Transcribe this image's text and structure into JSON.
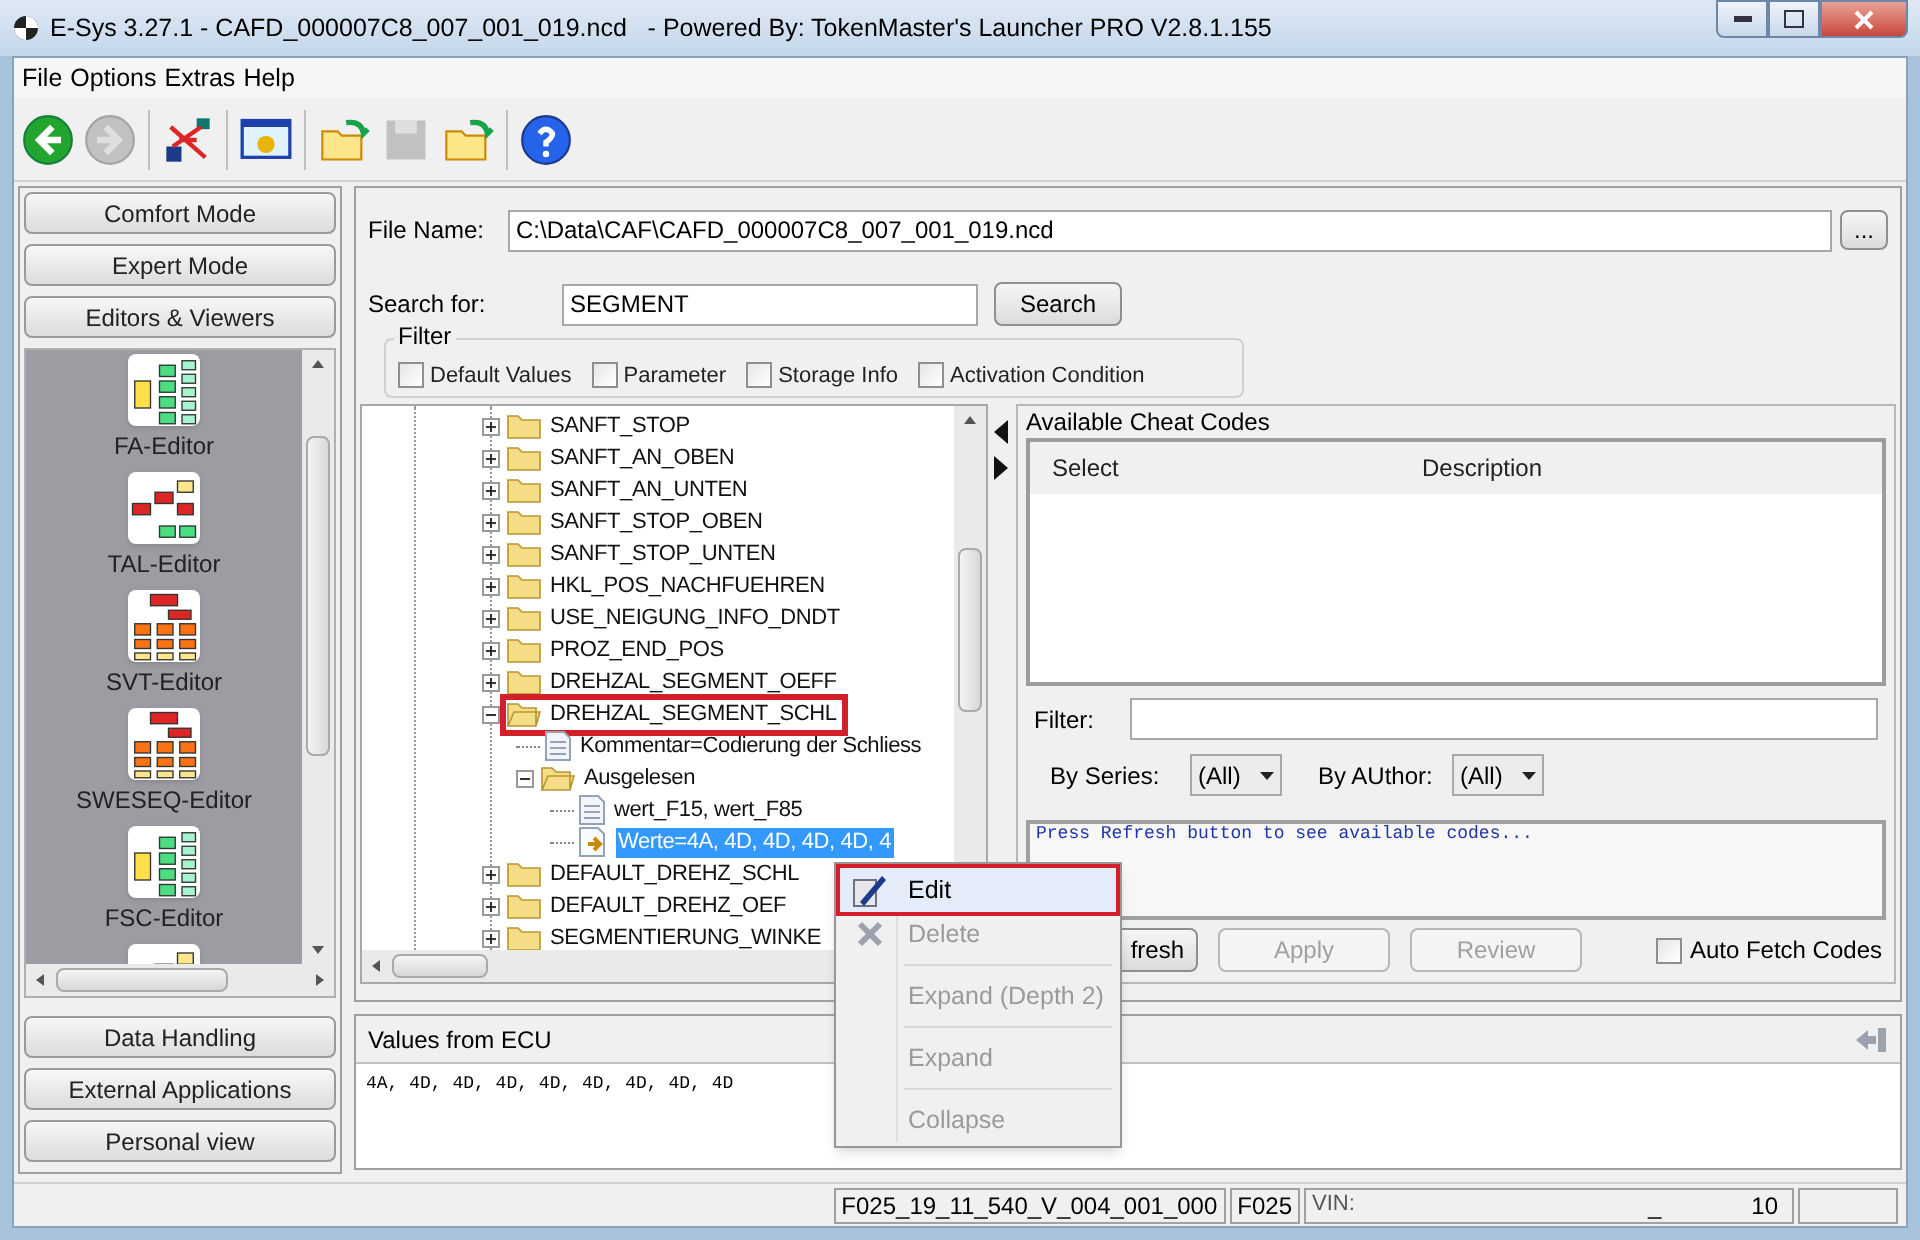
{
  "window": {
    "title": "E-Sys 3.27.1 - CAFD_000007C8_007_001_019.ncd   - Powered By: TokenMaster's Launcher PRO V2.8.1.155"
  },
  "menu": [
    "File",
    "Options",
    "Extras",
    "Help"
  ],
  "toolbar": [
    {
      "kind": "back",
      "disabled": false
    },
    {
      "kind": "forward",
      "disabled": true
    },
    {
      "kind": "network",
      "disabled": false
    },
    {
      "kind": "monitor",
      "disabled": false
    },
    {
      "kind": "open",
      "disabled": false
    },
    {
      "kind": "save",
      "disabled": true
    },
    {
      "kind": "open",
      "disabled": false
    },
    {
      "kind": "help",
      "disabled": false
    }
  ],
  "sidebar": {
    "top_buttons": [
      "Comfort Mode",
      "Expert Mode",
      "Editors & Viewers"
    ],
    "editors": [
      {
        "label": "FA-Editor",
        "kind": "tree"
      },
      {
        "label": "TAL-Editor",
        "kind": "flow"
      },
      {
        "label": "SVT-Editor",
        "kind": "hierarchy"
      },
      {
        "label": "SWESEQ-Editor",
        "kind": "hierarchy"
      },
      {
        "label": "FSC-Editor",
        "kind": "tree"
      },
      {
        "kind": "flow"
      }
    ],
    "bottom_buttons": [
      "Data Handling",
      "External Applications",
      "Personal view"
    ]
  },
  "file_name": {
    "label": "File Name:",
    "value": "C:\\Data\\CAF\\CAFD_000007C8_007_001_019.ncd",
    "browse": "..."
  },
  "search": {
    "label": "Search for:",
    "value": "SEGMENT",
    "button": "Search"
  },
  "filter": {
    "title": "Filter",
    "options": [
      {
        "label": "Default Values",
        "checked": false
      },
      {
        "label": "Parameter",
        "checked": false
      },
      {
        "label": "Storage Info",
        "checked": false
      },
      {
        "label": "Activation Condition",
        "checked": false
      }
    ]
  },
  "tree": [
    {
      "label": "SANFT_STOP",
      "kind": "folder",
      "expanded": false,
      "selected": false,
      "highlighted": false
    },
    {
      "label": "SANFT_AN_OBEN",
      "kind": "folder",
      "expanded": false,
      "selected": false,
      "highlighted": false
    },
    {
      "label": "SANFT_AN_UNTEN",
      "kind": "folder",
      "expanded": false,
      "selected": false,
      "highlighted": false
    },
    {
      "label": "SANFT_STOP_OBEN",
      "kind": "folder",
      "expanded": false,
      "selected": false,
      "highlighted": false
    },
    {
      "label": "SANFT_STOP_UNTEN",
      "kind": "folder",
      "expanded": false,
      "selected": false,
      "highlighted": false
    },
    {
      "label": "HKL_POS_NACHFUEHREN",
      "kind": "folder",
      "expanded": false,
      "selected": false,
      "highlighted": false
    },
    {
      "label": "USE_NEIGUNG_INFO_DNDT",
      "kind": "folder",
      "expanded": false,
      "selected": false,
      "highlighted": false
    },
    {
      "label": "PROZ_END_POS",
      "kind": "folder",
      "expanded": false,
      "selected": false,
      "highlighted": false
    },
    {
      "label": "DREHZAL_SEGMENT_OEFF",
      "kind": "folder",
      "expanded": false,
      "selected": false,
      "highlighted": false
    },
    {
      "label": "DREHZAL_SEGMENT_SCHL",
      "kind": "folder",
      "expanded": true,
      "selected": false,
      "highlighted": true,
      "children": [
        {
          "label": "Kommentar=Codierung der Schliess",
          "kind": "comment",
          "selected": false,
          "highlighted": false
        },
        {
          "label": "Ausgelesen",
          "kind": "folder",
          "expanded": true,
          "selected": false,
          "highlighted": false,
          "children": [
            {
              "label": "wert_F15, wert_F85",
              "kind": "comment",
              "selected": false,
              "highlighted": false
            },
            {
              "label": "Werte=4A, 4D, 4D, 4D, 4D, 4",
              "kind": "value",
              "selected": true,
              "highlighted": false
            }
          ]
        }
      ]
    },
    {
      "label": "DEFAULT_DREHZ_SCHL",
      "kind": "folder",
      "expanded": false,
      "selected": false,
      "highlighted": false
    },
    {
      "label": "DEFAULT_DREHZ_OEF",
      "kind": "folder",
      "expanded": false,
      "selected": false,
      "highlighted": false
    },
    {
      "label": "SEGMENTIERUNG_WINKE",
      "kind": "folder",
      "expanded": false,
      "selected": false,
      "highlighted": false
    }
  ],
  "cheat_codes": {
    "title": "Available Cheat Codes",
    "columns": [
      "Select",
      "Description"
    ],
    "filter_label": "Filter:",
    "series_label": "By Series:",
    "series_value": "(All)",
    "author_label": "By AUthor:",
    "author_value": "(All)",
    "message": "Press Refresh button to see available codes...",
    "buttons": [
      {
        "label": "fresh",
        "disabled": false
      },
      {
        "label": "Apply",
        "disabled": true
      },
      {
        "label": "Review",
        "disabled": true
      }
    ],
    "auto_fetch": {
      "label": "Auto Fetch Codes",
      "checked": false
    }
  },
  "values_from_ecu": {
    "title": "Values from ECU",
    "text": "4A, 4D, 4D, 4D, 4D, 4D, 4D, 4D, 4D"
  },
  "context_menu": [
    {
      "label": "Edit",
      "disabled": false,
      "selected": true,
      "highlighted": true
    },
    {
      "label": "Delete",
      "disabled": true,
      "selected": false,
      "highlighted": false
    },
    {
      "label": "Expand (Depth 2)",
      "disabled": true,
      "selected": false,
      "highlighted": false
    },
    {
      "label": "Expand",
      "disabled": true,
      "selected": false,
      "highlighted": false
    },
    {
      "label": "Collapse",
      "disabled": true,
      "selected": false,
      "highlighted": false
    }
  ],
  "status_bar": {
    "target": "F025_19_11_540_V_004_001_000",
    "series": "F025",
    "vin_label": "VIN:",
    "vin_value": "_",
    "count": "10"
  }
}
